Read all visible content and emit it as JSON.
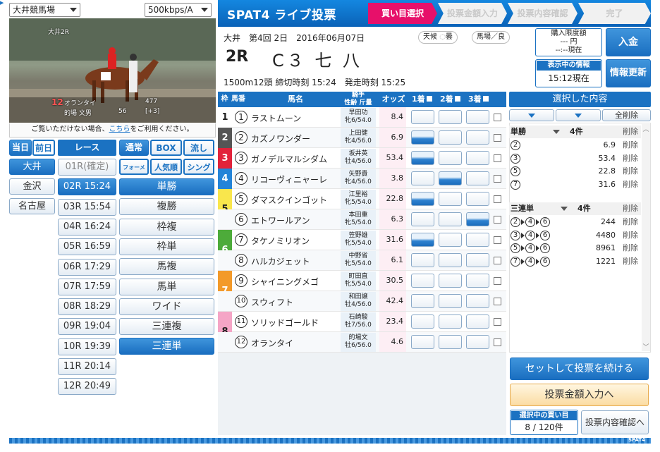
{
  "venue_select": "大井競馬場",
  "bitrate_select": "500kbps/A",
  "video": {
    "race_label": "大井2R",
    "horse_no": "12",
    "horse_name": "オランタイ",
    "weight": "477",
    "jockey": "的場 文男",
    "age": "56",
    "diff": "[+3]"
  },
  "video_note": {
    "prefix": "ご覧いただけない場合、",
    "link": "こちら",
    "suffix": "をご利用ください。"
  },
  "day_tabs": [
    "当日",
    "前日"
  ],
  "venues": [
    "大井",
    "金沢",
    "名古屋"
  ],
  "race_header": "レース",
  "races": [
    "01R(確定)",
    "02R 15:24",
    "03R 15:54",
    "04R 16:24",
    "05R 16:59",
    "06R 17:29",
    "07R 17:59",
    "08R 18:29",
    "09R 19:04",
    "10R 19:39",
    "11R 20:14",
    "12R 20:49"
  ],
  "mode_tabs": [
    "通常",
    "BOX",
    "流し"
  ],
  "mode_tabs2": [
    "フォーメーション",
    "人気順",
    "シングル"
  ],
  "bet_types": [
    "単勝",
    "複勝",
    "枠複",
    "枠単",
    "馬複",
    "馬単",
    "ワイド",
    "三連複",
    "三連単"
  ],
  "header": {
    "logo": "SPAT4 ライブ投票",
    "steps": [
      "買い目選択",
      "投票金額入力",
      "投票内容確認",
      "完了"
    ]
  },
  "race_info": {
    "meeting": "大井　第4回 2日　2016年06月07日",
    "race_no": "2R",
    "race_class": "C３ 七 八",
    "details": "1500m12頭 締切時刻 15:24　発走時刻 15:25",
    "weather_label": "天候",
    "weather": "曇",
    "track_label": "馬場",
    "track": "良"
  },
  "limit": {
    "label": "購入限度額",
    "amount": "--- 円",
    "time": "--:--現在"
  },
  "deposit_button": "入金",
  "current_info": {
    "label": "表示中の情報",
    "time": "15:12現在"
  },
  "refresh_button": "情報更新",
  "table_headers": {
    "waku": "枠番",
    "uma": "馬番",
    "name": "馬名",
    "jockey": "騎手",
    "jockey2": "性齢 斤量",
    "odds": "オッズ",
    "first": "1着",
    "second": "2着",
    "third": "3着"
  },
  "horses": [
    {
      "waku": "1",
      "no": "1",
      "name": "ラストムーン",
      "jockey": "早田功",
      "info": "牝6/54.0",
      "odds": "8.4"
    },
    {
      "waku": "2",
      "no": "2",
      "name": "カズノワンダー",
      "jockey": "上田健",
      "info": "牝4/56.0",
      "odds": "6.9"
    },
    {
      "waku": "3",
      "no": "3",
      "name": "ガノデルマルシダム",
      "jockey": "坂井英",
      "info": "牡4/56.0",
      "odds": "53.4"
    },
    {
      "waku": "4",
      "no": "4",
      "name": "リコーヴィニャーレ",
      "jockey": "矢野貴",
      "info": "牝4/56.0",
      "odds": "3.8"
    },
    {
      "waku": "5",
      "no": "5",
      "name": "ダマスクインゴット",
      "jockey": "江里裕",
      "info": "牝5/54.0",
      "odds": "22.8"
    },
    {
      "waku": "",
      "no": "6",
      "name": "エトワールアン",
      "jockey": "本田重",
      "info": "牝5/54.0",
      "odds": "6.3"
    },
    {
      "waku": "6",
      "no": "7",
      "name": "タケノミリオン",
      "jockey": "笠野雄",
      "info": "牝5/54.0",
      "odds": "31.6"
    },
    {
      "waku": "",
      "no": "8",
      "name": "ハルカジェット",
      "jockey": "中野省",
      "info": "牝5/54.0",
      "odds": "6.1"
    },
    {
      "waku": "7",
      "no": "9",
      "name": "シャイニングメゴ",
      "jockey": "町田直",
      "info": "牝5/54.0",
      "odds": "30.5"
    },
    {
      "waku": "",
      "no": "10",
      "name": "スウィフト",
      "jockey": "和田譲",
      "info": "牡4/56.0",
      "odds": "42.4"
    },
    {
      "waku": "8",
      "no": "11",
      "name": "ソリッドゴールド",
      "jockey": "石崎駿",
      "info": "牡7/56.0",
      "odds": "23.4"
    },
    {
      "waku": "",
      "no": "12",
      "name": "オランタイ",
      "jockey": "的場文",
      "info": "牡6/56.0",
      "odds": "4.6"
    }
  ],
  "selection": {
    "header": "選択した内容",
    "clear_all": "全削除",
    "delete_label": "削除",
    "groups": [
      {
        "type": "単勝",
        "count": "4件",
        "items": [
          {
            "combo": [
              "2"
            ],
            "odds": "6.9"
          },
          {
            "combo": [
              "3"
            ],
            "odds": "53.4"
          },
          {
            "combo": [
              "5"
            ],
            "odds": "22.8"
          },
          {
            "combo": [
              "7"
            ],
            "odds": "31.6"
          }
        ]
      },
      {
        "type": "三連単",
        "count": "4件",
        "items": [
          {
            "combo": [
              "2",
              "4",
              "6"
            ],
            "odds": "244"
          },
          {
            "combo": [
              "3",
              "4",
              "6"
            ],
            "odds": "4480"
          },
          {
            "combo": [
              "5",
              "4",
              "6"
            ],
            "odds": "8961"
          },
          {
            "combo": [
              "7",
              "4",
              "6"
            ],
            "odds": "1221"
          }
        ]
      }
    ]
  },
  "continue_button": "セットして投票を続ける",
  "amount_button": "投票金額入力へ",
  "selected_count": {
    "label": "選択中の買い目",
    "value": "8 / 120件"
  },
  "confirm_button": "投票内容確認へ",
  "footer_logo": "SPAT4",
  "colors": {
    "primary": "#1b72c2",
    "accent": "#e7106a"
  }
}
